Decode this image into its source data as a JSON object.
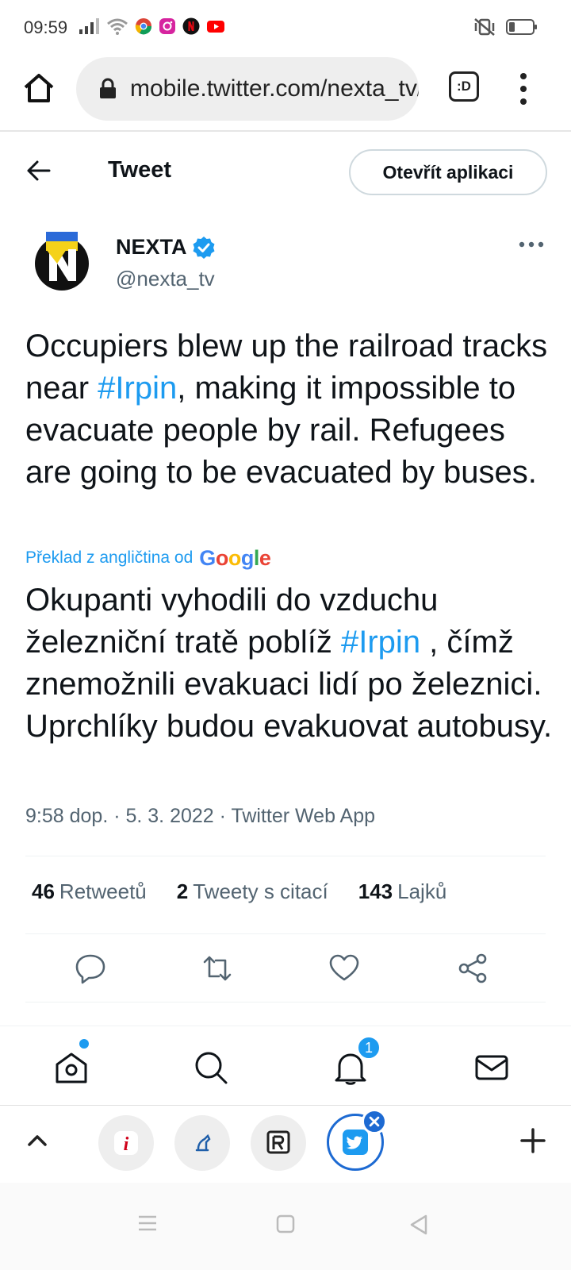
{
  "status_bar": {
    "time": "09:59"
  },
  "browser": {
    "url": "mobile.twitter.com/nexta_tv/status",
    "tab_label": ":D"
  },
  "header": {
    "title": "Tweet",
    "open_app_label": "Otevřít aplikaci"
  },
  "author": {
    "name": "NEXTA",
    "handle": "@nexta_tv"
  },
  "tweet": {
    "text_before": "Occupiers blew up the railroad tracks near ",
    "hashtag": "#Irpin",
    "text_after": ", making it impossible to evacuate people by rail. Refugees are going to be evacuated by buses.",
    "translate_label": "Překlad z angličtina od",
    "google": "Google",
    "translated_before": "Okupanti vyhodili do vzduchu železniční tratě poblíž ",
    "translated_hashtag": "#Irpin",
    "translated_after": " , čímž znemožnili evakuaci lidí po železnici. Uprchlíky budou evakuovat autobusy.",
    "meta": "9:58 dop. · 5. 3. 2022 · Twitter Web App"
  },
  "stats": [
    {
      "count": "46",
      "label": "Retweetů"
    },
    {
      "count": "2",
      "label": "Tweety s citací"
    },
    {
      "count": "143",
      "label": "Lajků"
    }
  ],
  "nav": {
    "notifications_badge": "1"
  },
  "colors": {
    "accent": "#1d9bf0",
    "bubble_ring": "#1d6ad2"
  }
}
